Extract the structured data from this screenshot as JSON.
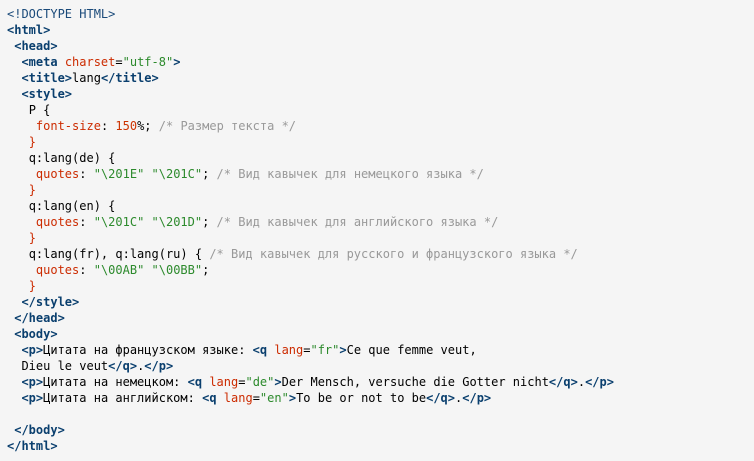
{
  "colors": {
    "background": "#f5f5f5",
    "tag": "#0a3f6e",
    "attribute": "#cc2b00",
    "string": "#2c8a2c",
    "comment": "#999999",
    "text": "#000000"
  },
  "code": [
    [
      {
        "t": "doctype",
        "v": "<!DOCTYPE HTML>"
      }
    ],
    [
      {
        "t": "tag",
        "v": "<html>"
      }
    ],
    [
      {
        "t": "text",
        "v": " "
      },
      {
        "t": "tag",
        "v": "<head>"
      }
    ],
    [
      {
        "t": "text",
        "v": "  "
      },
      {
        "t": "tag",
        "v": "<meta "
      },
      {
        "t": "attr",
        "v": "charset"
      },
      {
        "t": "punct",
        "v": "="
      },
      {
        "t": "val",
        "v": "\"utf-8\""
      },
      {
        "t": "tag",
        "v": ">"
      }
    ],
    [
      {
        "t": "text",
        "v": "  "
      },
      {
        "t": "tag",
        "v": "<title>"
      },
      {
        "t": "text",
        "v": "lang"
      },
      {
        "t": "tag",
        "v": "</title>"
      }
    ],
    [
      {
        "t": "text",
        "v": "  "
      },
      {
        "t": "tag",
        "v": "<style>"
      }
    ],
    [
      {
        "t": "text",
        "v": "   "
      },
      {
        "t": "sel",
        "v": "P "
      },
      {
        "t": "punct",
        "v": "{"
      }
    ],
    [
      {
        "t": "text",
        "v": "    "
      },
      {
        "t": "prop",
        "v": "font-size"
      },
      {
        "t": "punct",
        "v": ": "
      },
      {
        "t": "num",
        "v": "150"
      },
      {
        "t": "punct",
        "v": "%; "
      },
      {
        "t": "comment",
        "v": "/* Размер текста */"
      }
    ],
    [
      {
        "t": "text",
        "v": "   "
      },
      {
        "t": "brace",
        "v": "}"
      }
    ],
    [
      {
        "t": "text",
        "v": "   "
      },
      {
        "t": "sel",
        "v": "q:lang(de) "
      },
      {
        "t": "punct",
        "v": "{"
      }
    ],
    [
      {
        "t": "text",
        "v": "    "
      },
      {
        "t": "prop",
        "v": "quotes"
      },
      {
        "t": "punct",
        "v": ": "
      },
      {
        "t": "str",
        "v": "\"\\201E\" \"\\201C\""
      },
      {
        "t": "punct",
        "v": "; "
      },
      {
        "t": "comment",
        "v": "/* Вид кавычек для немецкого языка */"
      }
    ],
    [
      {
        "t": "text",
        "v": "   "
      },
      {
        "t": "brace",
        "v": "}"
      }
    ],
    [
      {
        "t": "text",
        "v": "   "
      },
      {
        "t": "sel",
        "v": "q:lang(en) "
      },
      {
        "t": "punct",
        "v": "{"
      }
    ],
    [
      {
        "t": "text",
        "v": "    "
      },
      {
        "t": "prop",
        "v": "quotes"
      },
      {
        "t": "punct",
        "v": ": "
      },
      {
        "t": "str",
        "v": "\"\\201C\" \"\\201D\""
      },
      {
        "t": "punct",
        "v": "; "
      },
      {
        "t": "comment",
        "v": "/* Вид кавычек для английского языка */"
      }
    ],
    [
      {
        "t": "text",
        "v": "   "
      },
      {
        "t": "brace",
        "v": "}"
      }
    ],
    [
      {
        "t": "text",
        "v": "   "
      },
      {
        "t": "sel",
        "v": "q:lang(fr), q:lang(ru) "
      },
      {
        "t": "punct",
        "v": "{ "
      },
      {
        "t": "comment",
        "v": "/* Вид кавычек для русского и французского языка */"
      }
    ],
    [
      {
        "t": "text",
        "v": "    "
      },
      {
        "t": "prop",
        "v": "quotes"
      },
      {
        "t": "punct",
        "v": ": "
      },
      {
        "t": "str",
        "v": "\"\\00AB\" \"\\00BB\""
      },
      {
        "t": "punct",
        "v": ";"
      }
    ],
    [
      {
        "t": "text",
        "v": "   "
      },
      {
        "t": "brace",
        "v": "}"
      }
    ],
    [
      {
        "t": "text",
        "v": "  "
      },
      {
        "t": "tag",
        "v": "</style>"
      }
    ],
    [
      {
        "t": "text",
        "v": " "
      },
      {
        "t": "tag",
        "v": "</head>"
      }
    ],
    [
      {
        "t": "text",
        "v": " "
      },
      {
        "t": "tag",
        "v": "<body>"
      }
    ],
    [
      {
        "t": "text",
        "v": "  "
      },
      {
        "t": "tag",
        "v": "<p>"
      },
      {
        "t": "text",
        "v": "Цитата на французском языке: "
      },
      {
        "t": "tag",
        "v": "<q "
      },
      {
        "t": "attr",
        "v": "lang"
      },
      {
        "t": "punct",
        "v": "="
      },
      {
        "t": "val",
        "v": "\"fr\""
      },
      {
        "t": "tag",
        "v": ">"
      },
      {
        "t": "text",
        "v": "Ce que femme veut,"
      }
    ],
    [
      {
        "t": "text",
        "v": "  Dieu le veut"
      },
      {
        "t": "tag",
        "v": "</q>"
      },
      {
        "t": "text",
        "v": "."
      },
      {
        "t": "tag",
        "v": "</p>"
      }
    ],
    [
      {
        "t": "text",
        "v": "  "
      },
      {
        "t": "tag",
        "v": "<p>"
      },
      {
        "t": "text",
        "v": "Цитата на немецком: "
      },
      {
        "t": "tag",
        "v": "<q "
      },
      {
        "t": "attr",
        "v": "lang"
      },
      {
        "t": "punct",
        "v": "="
      },
      {
        "t": "val",
        "v": "\"de\""
      },
      {
        "t": "tag",
        "v": ">"
      },
      {
        "t": "text",
        "v": "Der Mensch, versuche die Gotter nicht"
      },
      {
        "t": "tag",
        "v": "</q>"
      },
      {
        "t": "text",
        "v": "."
      },
      {
        "t": "tag",
        "v": "</p>"
      }
    ],
    [
      {
        "t": "text",
        "v": "  "
      },
      {
        "t": "tag",
        "v": "<p>"
      },
      {
        "t": "text",
        "v": "Цитата на английском: "
      },
      {
        "t": "tag",
        "v": "<q "
      },
      {
        "t": "attr",
        "v": "lang"
      },
      {
        "t": "punct",
        "v": "="
      },
      {
        "t": "val",
        "v": "\"en\""
      },
      {
        "t": "tag",
        "v": ">"
      },
      {
        "t": "text",
        "v": "To be or not to be"
      },
      {
        "t": "tag",
        "v": "</q>"
      },
      {
        "t": "text",
        "v": "."
      },
      {
        "t": "tag",
        "v": "</p>"
      }
    ],
    [
      {
        "t": "text",
        "v": ""
      }
    ],
    [
      {
        "t": "text",
        "v": " "
      },
      {
        "t": "tag",
        "v": "</body>"
      }
    ],
    [
      {
        "t": "tag",
        "v": "</html>"
      }
    ]
  ]
}
